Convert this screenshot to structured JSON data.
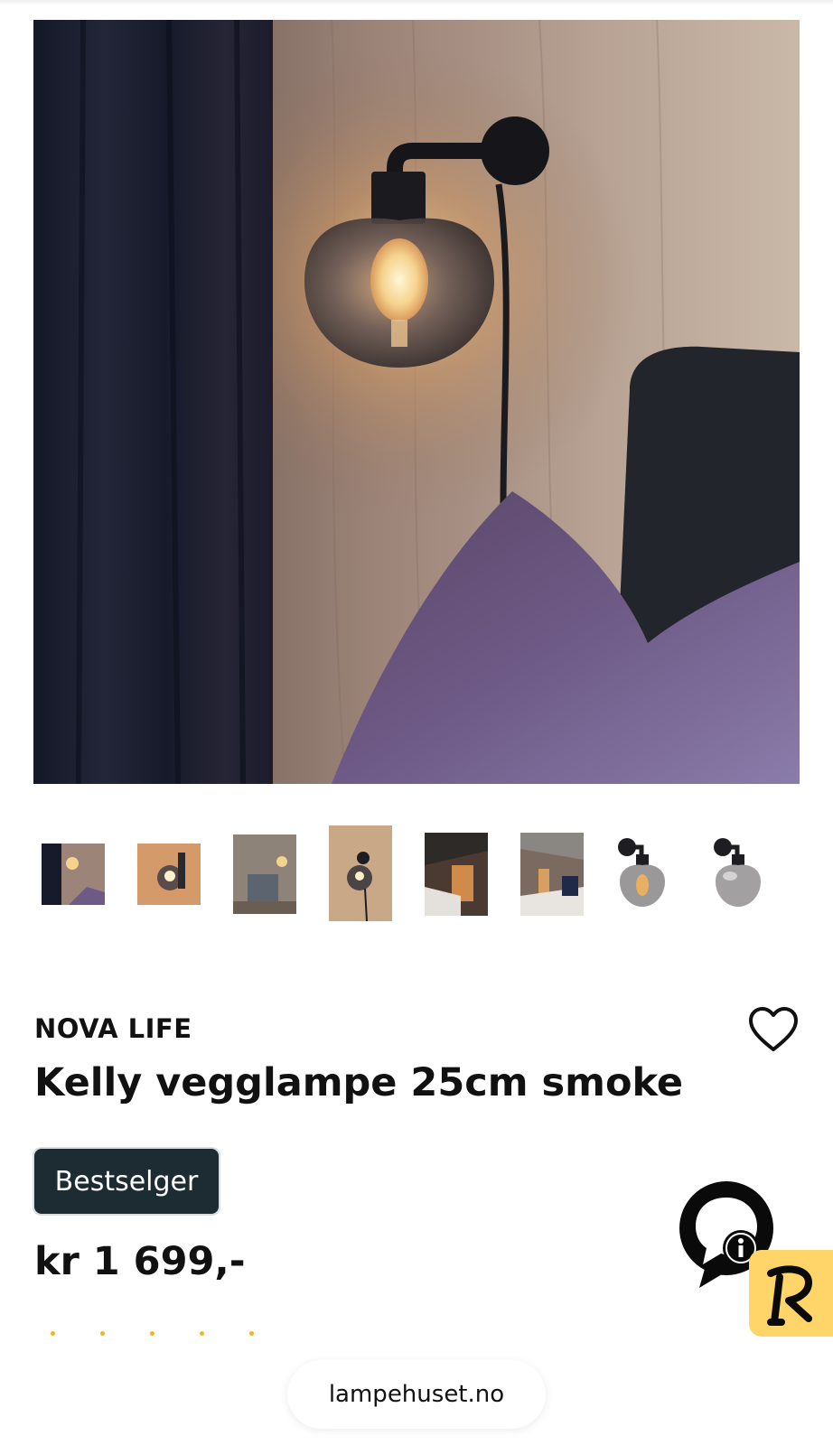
{
  "product": {
    "brand": "NOVA LIFE",
    "title": "Kelly vegglampe 25cm smoke",
    "badge": "Bestselger",
    "price": "kr 1 699,-",
    "rating_stars": 5
  },
  "gallery": {
    "thumbnail_count": 8,
    "selected_index": 3
  },
  "icons": {
    "wishlist": "heart-icon",
    "chat": "chat-bubble-icon",
    "reviews": "reviews-r-icon"
  },
  "colors": {
    "badge_bg": "#1d2b33",
    "star": "#f0b429",
    "reviews_badge": "#ffd56a"
  },
  "browser": {
    "url": "lampehuset.no"
  }
}
